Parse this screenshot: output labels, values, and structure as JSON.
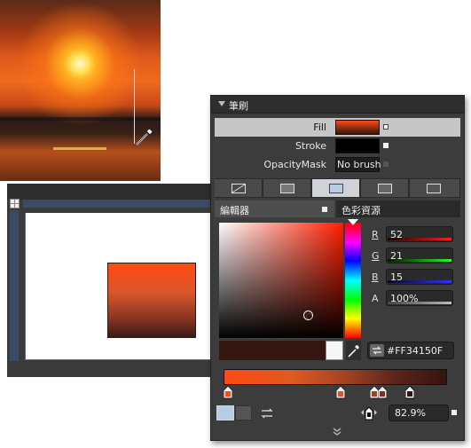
{
  "panel": {
    "title": "筆刷",
    "rows": [
      {
        "label": "Fill"
      },
      {
        "label": "Stroke"
      },
      {
        "label": "OpacityMask",
        "value": "No brush"
      }
    ],
    "editor_tabs": {
      "editor": "編輯器",
      "resources": "色彩資源"
    },
    "channels": [
      {
        "label": "R",
        "value": "52"
      },
      {
        "label": "G",
        "value": "21"
      },
      {
        "label": "B",
        "value": "15"
      },
      {
        "label": "A",
        "value": "100%"
      }
    ],
    "hex_value": "#FF34150F",
    "gradient_offset": "82.9%",
    "brush_types": [
      "no-brush",
      "solid-color",
      "gradient",
      "tile",
      "resource"
    ],
    "active_brush_type": "gradient"
  },
  "colors": {
    "selected": "#34150F",
    "fill_gradient_start": "#FF4A15",
    "fill_gradient_end": "#34150F",
    "stroke": "#000000"
  },
  "icons": [
    "eyedropper-cursor-icon",
    "grid-icon",
    "eyedropper-icon",
    "swap-icon",
    "chevron-down-icon",
    "reverse-gradient-icon"
  ]
}
